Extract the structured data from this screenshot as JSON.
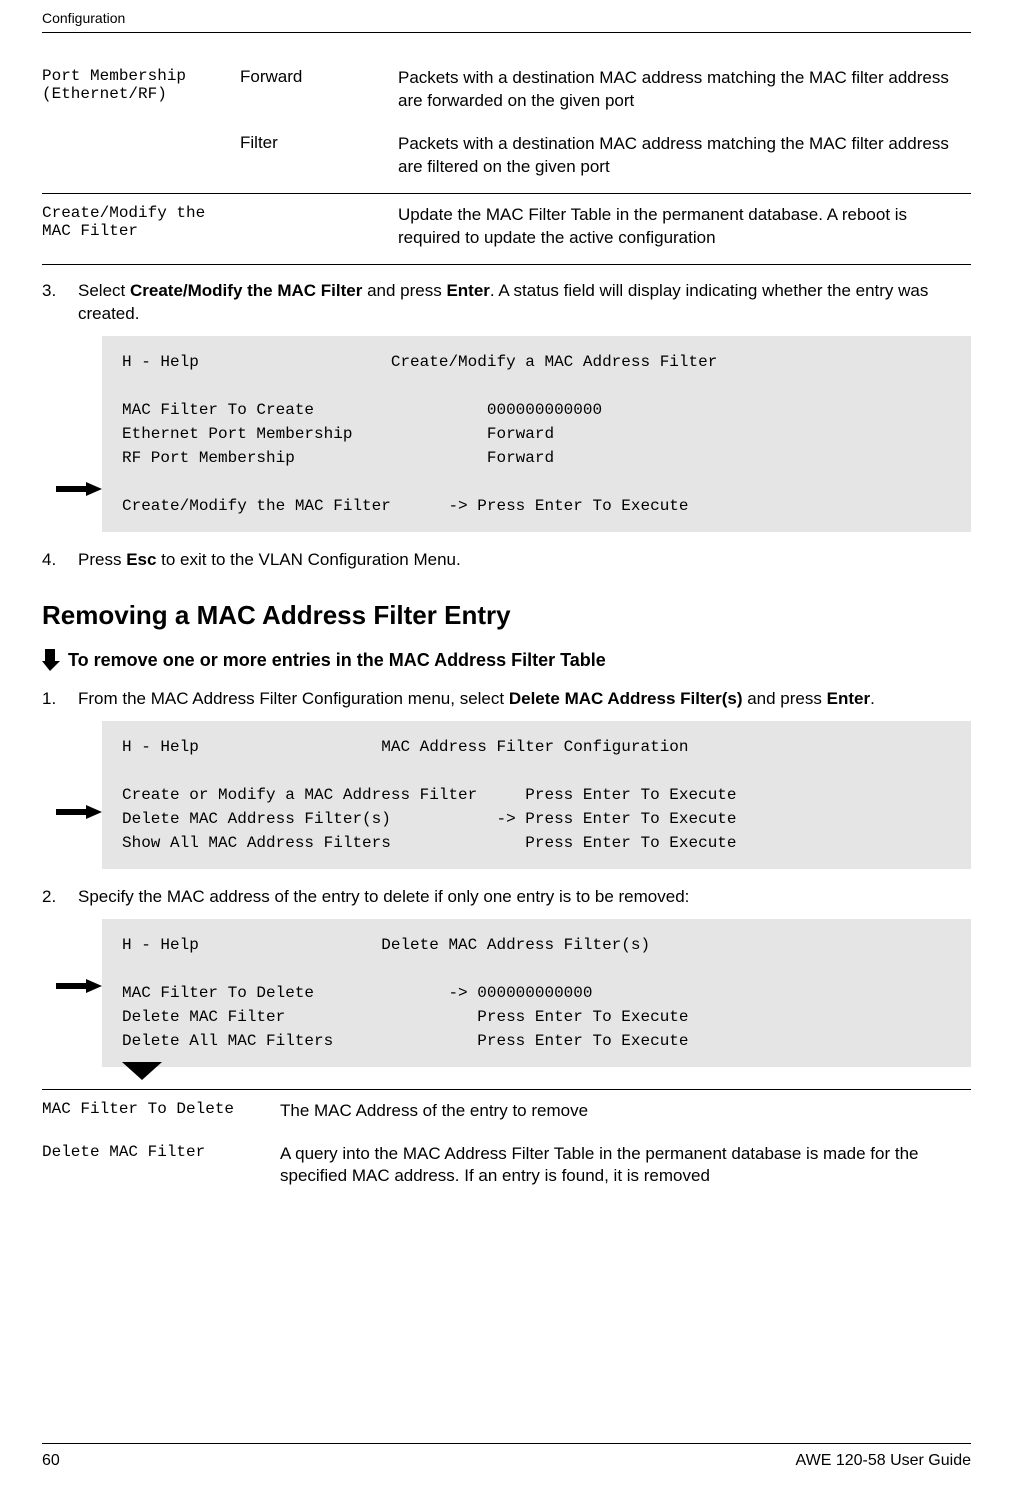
{
  "header": {
    "running": "Configuration"
  },
  "defs1": {
    "row1": {
      "item": "Port Membership (Ethernet/RF)",
      "opt": "Forward",
      "desc": "Packets with a destination MAC address matching the MAC filter address are forwarded on the given port"
    },
    "row2": {
      "opt": "Filter",
      "desc": "Packets with a destination MAC address matching the MAC filter address are filtered on the given port"
    },
    "row3": {
      "item": "Create/Modify the MAC Filter",
      "desc": "Update the MAC Filter Table in the permanent database.  A reboot is required to update the active configuration"
    }
  },
  "step3": {
    "num": "3.",
    "pre": "Select ",
    "bold1": "Create/Modify the MAC Filter",
    "mid": " and press ",
    "bold2": "Enter",
    "post": ". A status field will display indicating whether the entry was created."
  },
  "code1": "H - Help                    Create/Modify a MAC Address Filter\n\nMAC Filter To Create                  000000000000\nEthernet Port Membership              Forward\nRF Port Membership                    Forward\n\nCreate/Modify the MAC Filter      -> Press Enter To Execute",
  "step4": {
    "num": "4.",
    "pre": "Press ",
    "bold1": "Esc",
    "post": " to exit to the VLAN Configuration Menu."
  },
  "h2": "Removing a MAC Address Filter Entry",
  "task": "To remove one or more entries in the MAC Address Filter Table",
  "step1b": {
    "num": "1.",
    "pre": "From the MAC Address Filter Configuration menu, select ",
    "bold1": "Delete MAC Address Filter(s)",
    "mid": " and press ",
    "bold2": "Enter",
    "post": "."
  },
  "code2": "H - Help                   MAC Address Filter Configuration\n\nCreate or Modify a MAC Address Filter     Press Enter To Execute\nDelete MAC Address Filter(s)           -> Press Enter To Execute\nShow All MAC Address Filters              Press Enter To Execute",
  "step2b": {
    "num": "2.",
    "text": "Specify the MAC address of the entry to delete if only one entry is to be removed:"
  },
  "code3": "H - Help                   Delete MAC Address Filter(s)\n\nMAC Filter To Delete              -> 000000000000\nDelete MAC Filter                    Press Enter To Execute\nDelete All MAC Filters               Press Enter To Execute",
  "defs2": {
    "row1": {
      "item": "MAC Filter To Delete",
      "desc": "The MAC Address of the entry to remove"
    },
    "row2": {
      "item": "Delete MAC Filter",
      "desc": "A query into the MAC Address Filter Table in the permanent database is made for the specified MAC address. If an entry is found, it is removed"
    }
  },
  "footer": {
    "page": "60",
    "guide": "AWE 120-58 User Guide"
  }
}
